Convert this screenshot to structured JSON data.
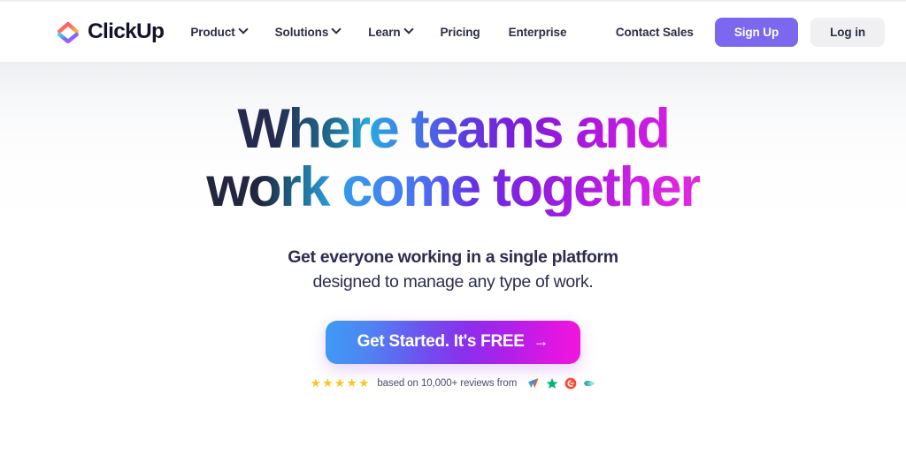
{
  "header": {
    "brand": {
      "name": "ClickUp",
      "logo_icon": "clickup-chevron-logo"
    },
    "nav": [
      {
        "label": "Product",
        "has_dropdown": true,
        "icon": "chevron-down-icon"
      },
      {
        "label": "Solutions",
        "has_dropdown": true,
        "icon": "chevron-down-icon"
      },
      {
        "label": "Learn",
        "has_dropdown": true,
        "icon": "chevron-down-icon"
      },
      {
        "label": "Pricing",
        "has_dropdown": false,
        "icon": ""
      },
      {
        "label": "Enterprise",
        "has_dropdown": false,
        "icon": ""
      }
    ],
    "contact_sales_label": "Contact Sales",
    "signup_label": "Sign Up",
    "login_label": "Log in",
    "signup_color": "#7B68EE",
    "login_color": "#F0F0F3"
  },
  "hero": {
    "headline_line1": "Where teams and",
    "headline_line2": "work come together",
    "headline_gradient_start": "#252A4E",
    "headline_gradient_mid": "#2AA7E0",
    "headline_gradient_end": "#DD22E2",
    "subhead_bold": "Get everyone working in a single platform",
    "subhead_regular": "designed to manage any type of work.",
    "cta_label": "Get Started. It's FREE",
    "cta_arrow": "→",
    "cta_gradient_start": "#3E9BF5",
    "cta_gradient_end": "#F215DD"
  },
  "reviews": {
    "star_count": 5,
    "star_glyph": "★",
    "star_color": "#FFC31F",
    "text": "based on 10,000+ reviews from",
    "logos": [
      {
        "name": "capterra-icon",
        "label": "Capterra"
      },
      {
        "name": "trustpilot-icon",
        "label": "Trustpilot"
      },
      {
        "name": "g2-icon",
        "label": "G2"
      },
      {
        "name": "getapp-icon",
        "label": "GetApp"
      }
    ]
  }
}
